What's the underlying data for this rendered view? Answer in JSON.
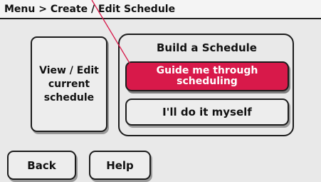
{
  "breadcrumb": {
    "text": "Menu > Create / Edit Schedule"
  },
  "view_edit_button": {
    "line1": "View / Edit",
    "line2": "current",
    "line3": "schedule"
  },
  "build_panel": {
    "title": "Build a Schedule",
    "guide_line1": "Guide me through",
    "guide_line2": "scheduling",
    "self_label": "I'll do it myself"
  },
  "footer": {
    "back_label": "Back",
    "help_label": "Help"
  },
  "colors": {
    "background": "#e9e9e9",
    "accent_button": "#d8194a",
    "pointer_line": "#d8194a"
  }
}
